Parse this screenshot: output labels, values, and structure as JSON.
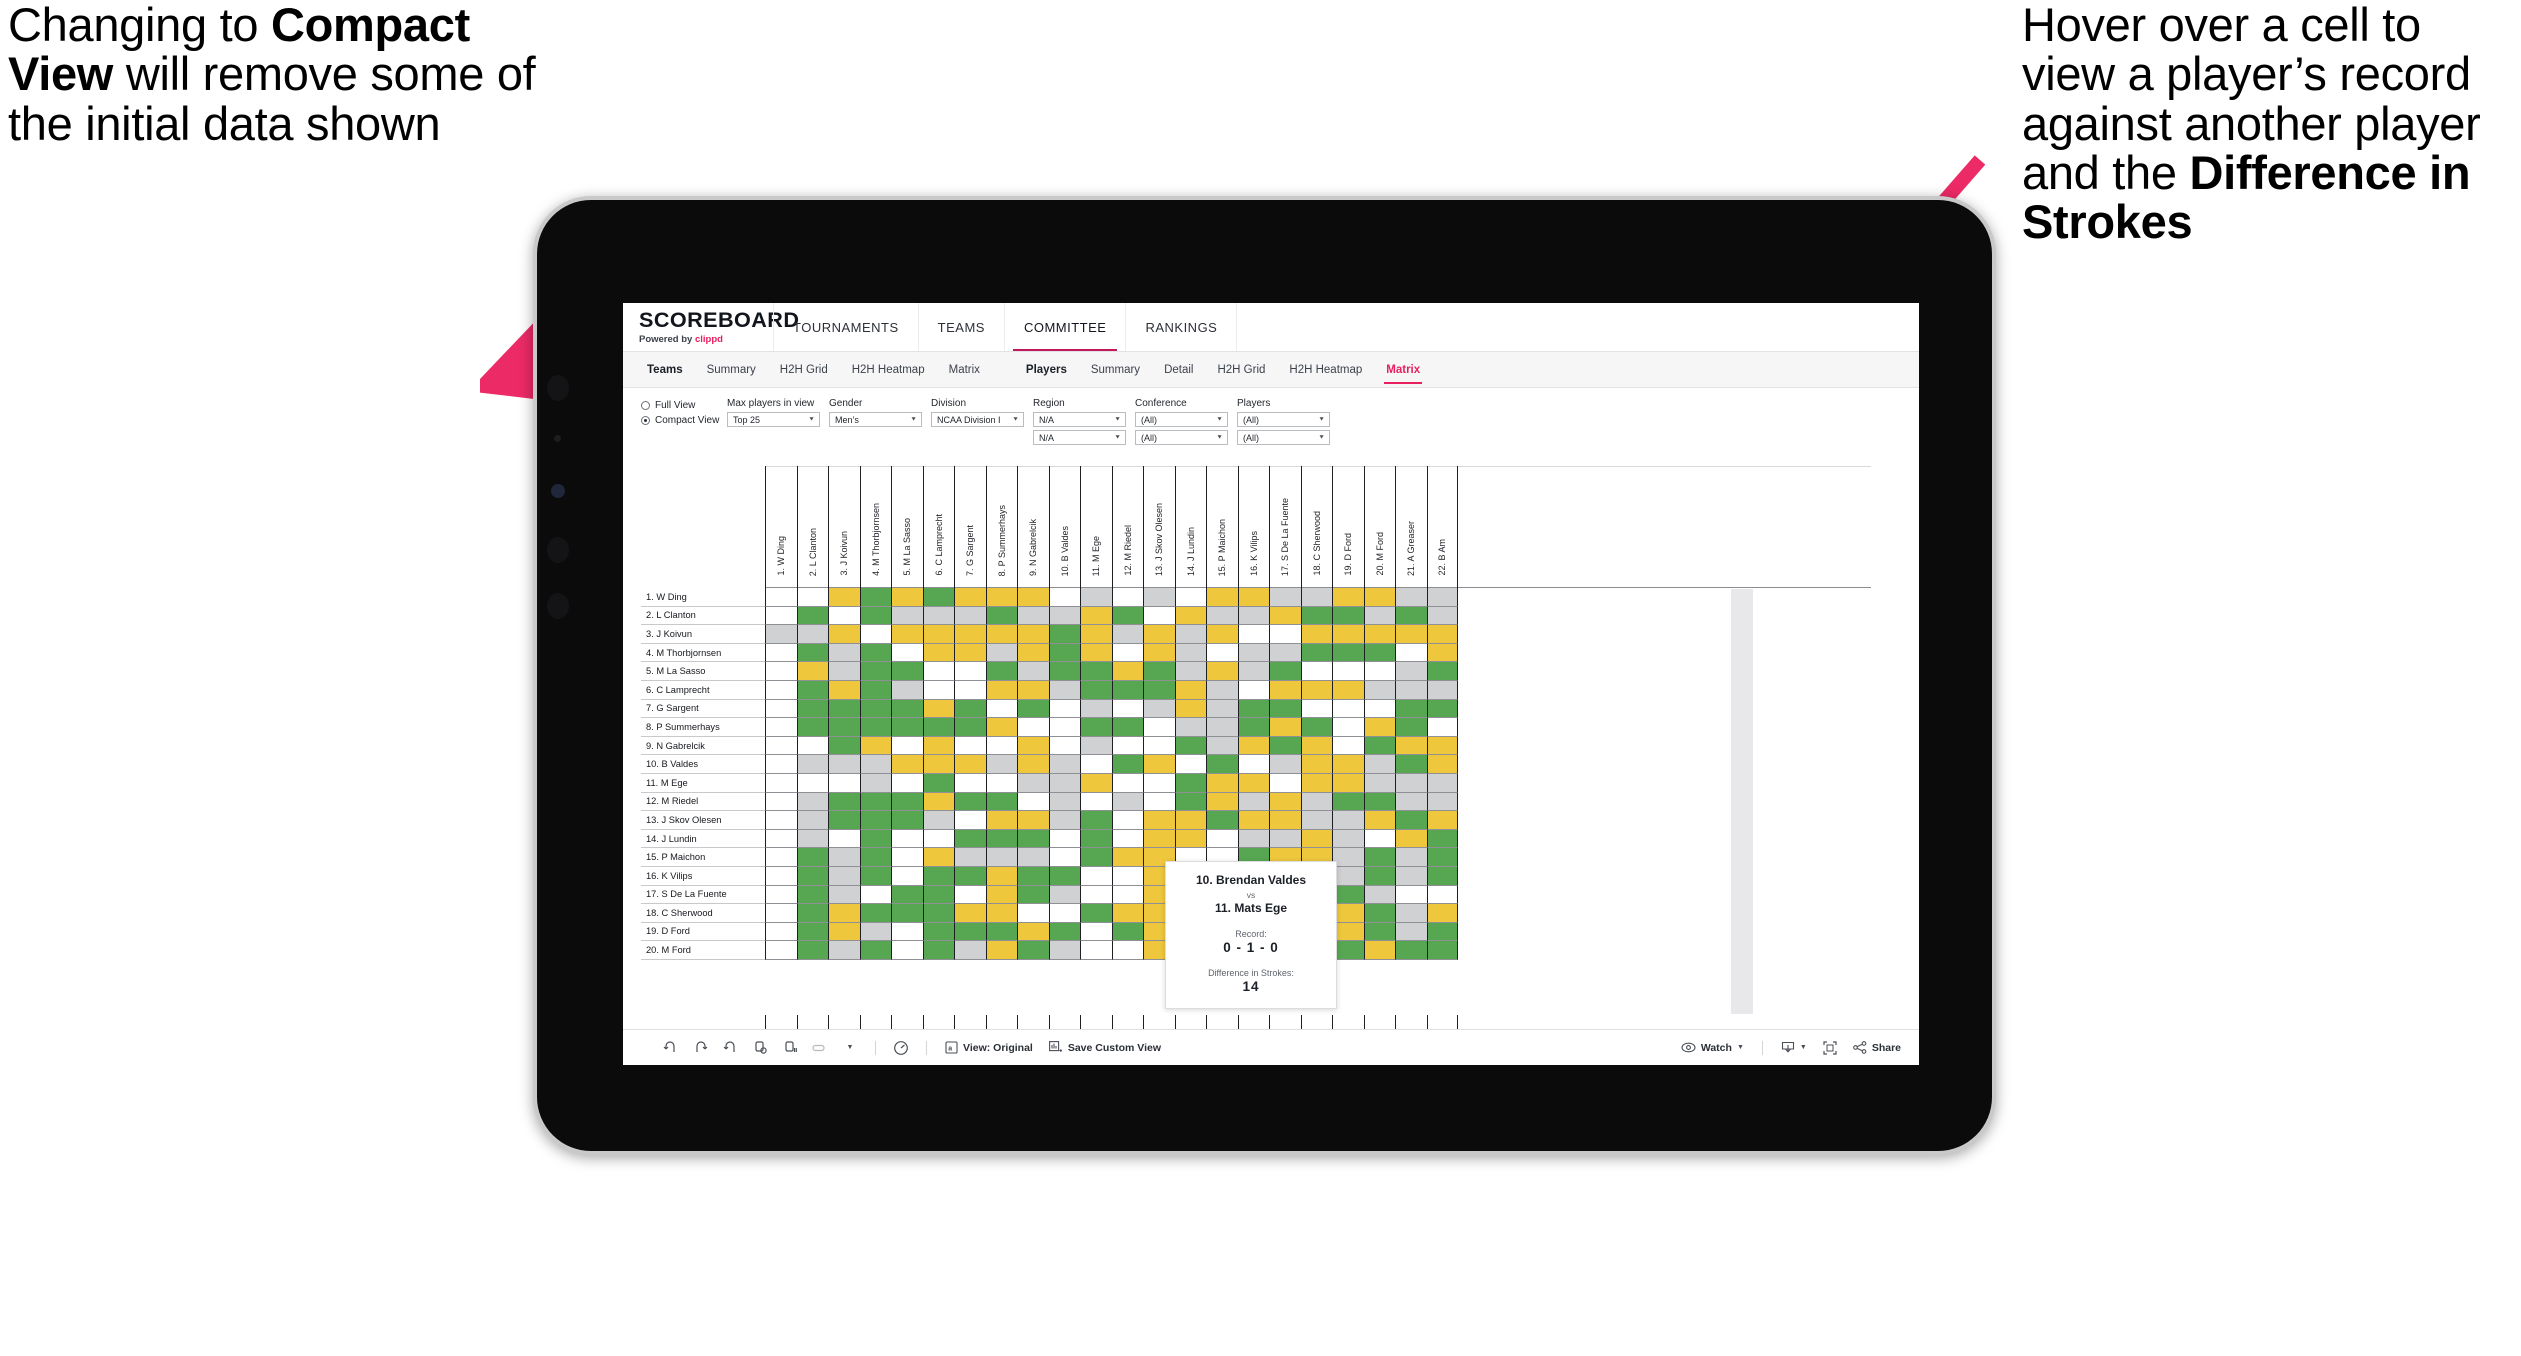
{
  "annotations": {
    "left": {
      "name": "compact-view-note",
      "part1": "Changing to ",
      "bold": "Compact View",
      "part2": " will remove some of the initial data shown"
    },
    "right": {
      "name": "hover-cell-note",
      "part1": "Hover over a cell to view a player’s record against another player and the ",
      "bold": "Difference in Strokes",
      "part2": ""
    },
    "arrow_color": "#ec2a66"
  },
  "app": {
    "brand": {
      "title": "SCOREBOARD",
      "powered_prefix": "Powered by ",
      "powered_brand": "clippd"
    },
    "topnav": [
      {
        "label": "TOURNAMENTS",
        "active": false
      },
      {
        "label": "TEAMS",
        "active": false
      },
      {
        "label": "COMMITTEE",
        "active": true
      },
      {
        "label": "RANKINGS",
        "active": false
      }
    ],
    "subtabs_left": [
      {
        "label": "Teams",
        "style": "bold"
      },
      {
        "label": "Summary",
        "style": "normal"
      },
      {
        "label": "H2H Grid",
        "style": "normal"
      },
      {
        "label": "H2H Heatmap",
        "style": "normal"
      },
      {
        "label": "Matrix",
        "style": "normal"
      }
    ],
    "subtabs_right": [
      {
        "label": "Players",
        "style": "bold"
      },
      {
        "label": "Summary",
        "style": "normal"
      },
      {
        "label": "Detail",
        "style": "normal"
      },
      {
        "label": "H2H Grid",
        "style": "normal"
      },
      {
        "label": "H2H Heatmap",
        "style": "normal"
      },
      {
        "label": "Matrix",
        "style": "active"
      }
    ],
    "accent_pink": "#e8205f",
    "accent_maroon": "#c2185b"
  },
  "filters": {
    "view_mode": {
      "options": [
        {
          "label": "Full View",
          "selected": false
        },
        {
          "label": "Compact View",
          "selected": true
        }
      ]
    },
    "dropdowns": [
      {
        "label": "Max players in view",
        "values": [
          "Top 25"
        ]
      },
      {
        "label": "Gender",
        "values": [
          "Men’s"
        ]
      },
      {
        "label": "Division",
        "values": [
          "NCAA Division I"
        ]
      },
      {
        "label": "Region",
        "values": [
          "N/A",
          "N/A"
        ]
      },
      {
        "label": "Conference",
        "values": [
          "(All)",
          "(All)"
        ]
      },
      {
        "label": "Players",
        "values": [
          "(All)",
          "(All)"
        ]
      }
    ]
  },
  "matrix": {
    "columns": [
      "1. W Ding",
      "2. L Clanton",
      "3. J Koivun",
      "4. M Thorbjornsen",
      "5. M La Sasso",
      "6. C Lamprecht",
      "7. G Sargent",
      "8. P Summerhays",
      "9. N Gabrelcik",
      "10. B Valdes",
      "11. M Ege",
      "12. M Riedel",
      "13. J Skov Olesen",
      "14. J Lundin",
      "15. P Maichon",
      "16. K Vilips",
      "17. S De La Fuente",
      "18. C Sherwood",
      "19. D Ford",
      "20. M Ford",
      "21. A Greaser",
      "22. B Am"
    ],
    "rows": [
      "1. W Ding",
      "2. L Clanton",
      "3. J Koivun",
      "4. M Thorbjornsen",
      "5. M La Sasso",
      "6. C Lamprecht",
      "7. G Sargent",
      "8. P Summerhays",
      "9. N Gabrelcik",
      "10. B Valdes",
      "11. M Ege",
      "12. M Riedel",
      "13. J Skov Olesen",
      "14. J Lundin",
      "15. P Maichon",
      "16. K Vilips",
      "17. S De La Fuente",
      "18. C Sherwood",
      "19. D Ford",
      "20. M Ford"
    ],
    "legend": {
      "win": "#57a752",
      "loss": "#eec73c",
      "tie": "#d0d1d2",
      "none": "#ffffff"
    },
    "cells": [
      "wwygygyyywswswyyssyyss",
      "wgwgsssgssygwyssyggsgs",
      "ssywyyyyygysysywwyyyyy",
      "wgsgwyysygywyswssgggwy",
      "wysggwwgsggygsysgwwwsg",
      "wgygswwyysgggyswyyysss",
      "wggggygwgwswsysggwwwgg",
      "wggggggyw ggwssgygwygw",
      "wwgywywwywswwgsygywgyy",
      "wsssyyysyswgywgwsyysgy",
      "wwwswgwwssywwgyywyysss",
      "wsgggygg s swgysysggss",
      "wsgggswyysgwyygyyssygy",
      "wswgwwggg gwyywssyswyg",
      "wgsgwysss gyywwgyysgsg",
      "wgsgwggygg wyswsyysgsg",
      "wgswgg ygsw yywsywgsww",
      "wgygggyyw gyywgwwyygsy",
      "wgyswgggyg gyyggwyygsg",
      "wgsgwgsygs wysgwwggygg"
    ]
  },
  "tooltip": {
    "player_a": "10. Brendan Valdes",
    "vs": "vs",
    "player_b": "11. Mats Ege",
    "record_label": "Record:",
    "record_value": "0 - 1 - 0",
    "diff_label": "Difference in Strokes:",
    "diff_value": "14"
  },
  "toolbar": {
    "icons": [
      "undo-icon",
      "redo-icon",
      "revert-icon",
      "refresh-icon",
      "pause-icon",
      "pill-icon",
      "chevron-down-icon"
    ],
    "help_icon": "help-icon",
    "view_label": "View: Original",
    "save_label": "Save Custom View",
    "watch_label": "Watch",
    "download_icon": "download-icon",
    "fullscreen_icon": "fullscreen-icon",
    "share_label": "Share"
  }
}
